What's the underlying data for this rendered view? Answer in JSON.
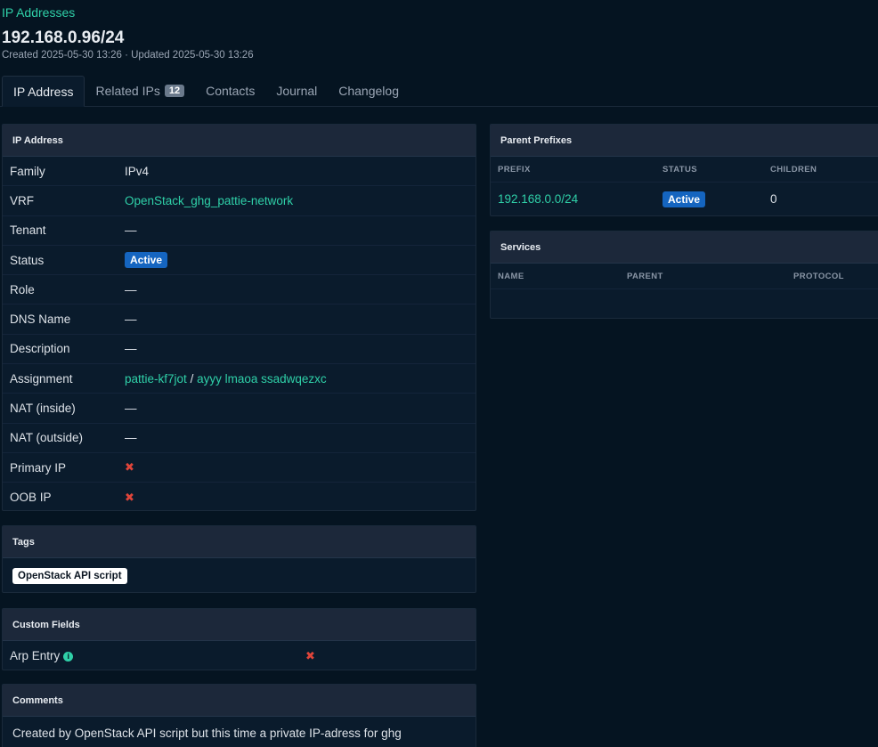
{
  "breadcrumb": "IP Addresses",
  "title": "192.168.0.96/24",
  "meta": "Created 2025-05-30 13:26 · Updated 2025-05-30 13:26",
  "tabs": [
    {
      "label": "IP Address"
    },
    {
      "label": "Related IPs",
      "count": "12"
    },
    {
      "label": "Contacts"
    },
    {
      "label": "Journal"
    },
    {
      "label": "Changelog"
    }
  ],
  "ip_card": {
    "title": "IP Address",
    "family_label": "Family",
    "family": "IPv4",
    "vrf_label": "VRF",
    "vrf": "OpenStack_ghg_pattie-network",
    "tenant_label": "Tenant",
    "tenant": "—",
    "status_label": "Status",
    "status": "Active",
    "role_label": "Role",
    "role": "—",
    "dns_label": "DNS Name",
    "dns": "—",
    "description_label": "Description",
    "description": "—",
    "assignment_label": "Assignment",
    "assignment_device": "pattie-kf7jot",
    "assignment_sep": "/",
    "assignment_interface": "ayyy lmaoa ssadwqezxc",
    "nat_inside_label": "NAT (inside)",
    "nat_inside": "—",
    "nat_outside_label": "NAT (outside)",
    "nat_outside": "—",
    "primary_ip_label": "Primary IP",
    "primary_ip": "✖",
    "oob_ip_label": "OOB IP",
    "oob_ip": "✖"
  },
  "tags_card": {
    "title": "Tags",
    "tags": [
      "OpenStack API script"
    ]
  },
  "custom_fields_card": {
    "title": "Custom Fields",
    "arp_label": "Arp Entry",
    "arp_info": "i",
    "arp_value": "✖"
  },
  "comments_card": {
    "title": "Comments",
    "text": "Created by OpenStack API script but this time a private IP-adress for ghg"
  },
  "parent_prefixes_card": {
    "title": "Parent Prefixes",
    "columns": [
      "PREFIX",
      "STATUS",
      "CHILDREN"
    ],
    "rows": [
      {
        "prefix": "192.168.0.0/24",
        "status": "Active",
        "children": "0"
      }
    ]
  },
  "services_card": {
    "title": "Services",
    "columns": [
      "NAME",
      "PARENT",
      "PROTOCOL"
    ]
  },
  "colors": {
    "accent": "#2fd0a8",
    "status_active": "#1565c0",
    "danger": "#e0453a",
    "background": "#051421"
  }
}
